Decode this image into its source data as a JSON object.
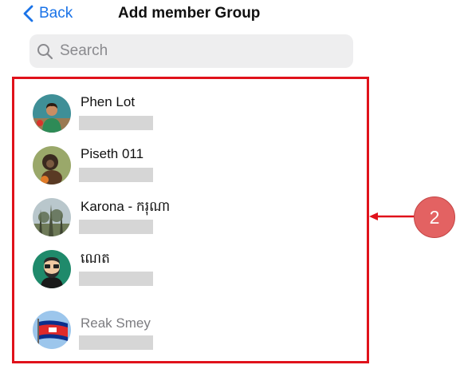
{
  "nav": {
    "back_label": "Back",
    "title": "Add member Group"
  },
  "search": {
    "placeholder": "Search",
    "value": ""
  },
  "members": [
    {
      "name": "Phen Lot",
      "icon": "avatar-person-green-shirt",
      "muted": false
    },
    {
      "name": "Piseth 011",
      "icon": "avatar-monkey",
      "muted": false
    },
    {
      "name": "Karona - ករុណា",
      "icon": "avatar-forest-landscape",
      "muted": false
    },
    {
      "name": "ណេត",
      "icon": "avatar-cartoon-bearded-man",
      "muted": false
    },
    {
      "name": "Reak Smey",
      "icon": "avatar-cambodia-flag",
      "muted": true
    }
  ],
  "annotation": {
    "number": "2",
    "border_color": "#e0121b",
    "circle_color": "#e36262"
  },
  "colors": {
    "accent": "#1a73e8",
    "placeholder_bar": "#d6d6d6"
  }
}
